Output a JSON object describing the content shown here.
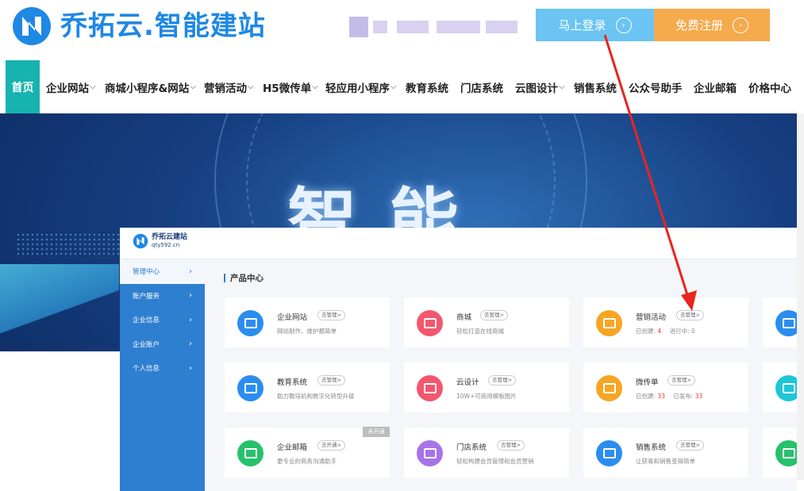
{
  "header": {
    "brand": "乔拓云.智能建站",
    "login_label": "马上登录",
    "register_label": "免费注册"
  },
  "nav": {
    "home": "首页",
    "items": [
      {
        "label": "企业网站",
        "dropdown": true
      },
      {
        "label": "商城小程序&网站",
        "dropdown": true
      },
      {
        "label": "营销活动",
        "dropdown": true
      },
      {
        "label": "H5微传单",
        "dropdown": true
      },
      {
        "label": "轻应用小程序",
        "dropdown": true
      },
      {
        "label": "教育系统",
        "dropdown": false
      },
      {
        "label": "门店系统",
        "dropdown": false
      },
      {
        "label": "云图设计",
        "dropdown": true
      },
      {
        "label": "销售系统",
        "dropdown": false
      },
      {
        "label": "公众号助手",
        "dropdown": false
      },
      {
        "label": "企业邮箱",
        "dropdown": false
      },
      {
        "label": "价格中心",
        "dropdown": false
      }
    ]
  },
  "banner": {
    "headline": "智能"
  },
  "panel": {
    "brand": "乔拓云建站",
    "domain": "qty592.cn",
    "sidebar": [
      {
        "label": "管理中心",
        "active": true
      },
      {
        "label": "账户服务",
        "active": false
      },
      {
        "label": "企业信息",
        "active": false
      },
      {
        "label": "企业账户",
        "active": false
      },
      {
        "label": "个人信息",
        "active": false
      }
    ],
    "section_title": "产品中心",
    "products": [
      {
        "name": "企业网站",
        "tag": "去管理>",
        "desc": "网站制作、维护都简单",
        "color": "#2b8df0"
      },
      {
        "name": "商城",
        "tag": "去管理>",
        "desc": "轻松打造在线商城",
        "color": "#f4566e"
      },
      {
        "name": "营销活动",
        "tag": "去管理>",
        "desc_label_1": "已创建:",
        "desc_value_1": "4",
        "desc_label_2": "进行中:",
        "desc_value_2": "0",
        "color": "#f6a623"
      },
      {
        "name": "教育系统",
        "tag": "去管理>",
        "desc": "助力教培机构数字化转型升级",
        "color": "#2b8df0"
      },
      {
        "name": "云设计",
        "tag": "去管理>",
        "desc": "10W+可商用模板图片",
        "color": "#f4566e"
      },
      {
        "name": "微传单",
        "tag": "去管理>",
        "desc_label_1": "已创建:",
        "desc_value_1": "33",
        "desc_label_2": "已发布:",
        "desc_value_2": "33",
        "color": "#f6a623"
      },
      {
        "name": "企业邮箱",
        "tag": "去开通>",
        "desc": "更专业的商务沟通助手",
        "badge": "未开通",
        "color": "#27c16b"
      },
      {
        "name": "门店系统",
        "tag": "去管理>",
        "desc": "轻松构建会员管理和会员营销",
        "color": "#a873e8"
      },
      {
        "name": "销售系统",
        "tag": "去管理>",
        "desc": "让获客和销售变得简单",
        "color": "#2b8df0"
      }
    ],
    "partial_colors": [
      "#2b8df0",
      "#1ec6d8",
      "#27c16b"
    ]
  },
  "annotation_color": "#e8251e"
}
